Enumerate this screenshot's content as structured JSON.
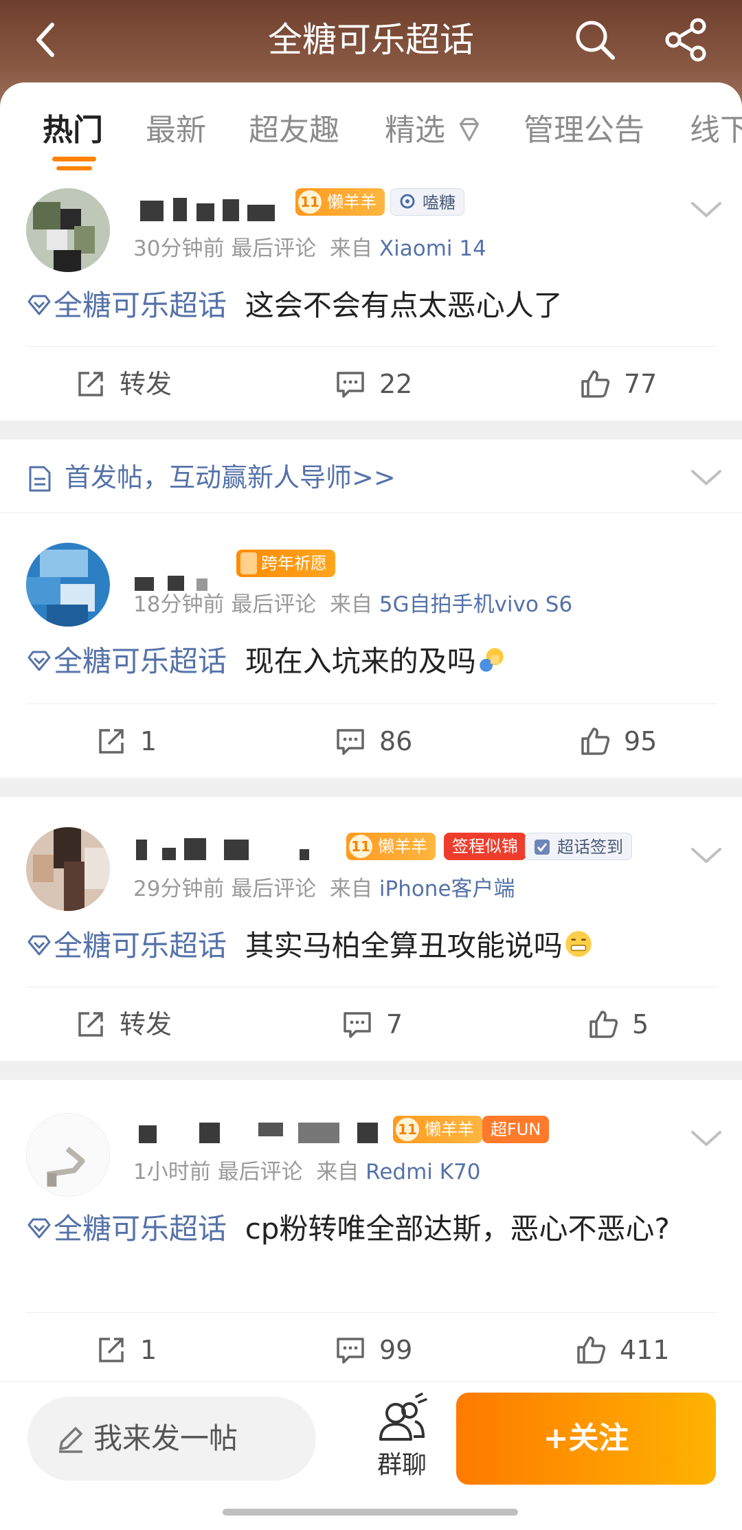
{
  "header": {
    "title": "全糖可乐超话"
  },
  "tabs": [
    "热门",
    "最新",
    "超友趣",
    "精选",
    "管理公告",
    "线下"
  ],
  "colors": {
    "accent": "#ff8200",
    "link": "#5572a8",
    "header_bg": "#6e3f2c"
  },
  "posts": [
    {
      "badges": [
        "懒羊羊",
        "嗑糖"
      ],
      "badge_level": "11",
      "meta": {
        "time": "30分钟前",
        "sort": "最后评论",
        "from_prefix": "来自",
        "source": "Xiaomi 14"
      },
      "topic": "全糖可乐超话",
      "text": "这会不会有点太恶心人了",
      "actions": {
        "repost": "转发",
        "comments": "22",
        "likes": "77"
      }
    },
    {
      "badges": [
        "跨年祈愿"
      ],
      "meta": {
        "time": "18分钟前",
        "sort": "最后评论",
        "from_prefix": "来自",
        "source": "5G自拍手机vivo S6"
      },
      "topic": "全糖可乐超话",
      "text": "现在入坑来的及吗",
      "actions": {
        "repost": "1",
        "comments": "86",
        "likes": "95"
      }
    },
    {
      "badges": [
        "懒羊羊",
        "签程似锦",
        "超话签到"
      ],
      "badge_level": "11",
      "meta": {
        "time": "29分钟前",
        "sort": "最后评论",
        "from_prefix": "来自",
        "source": "iPhone客户端"
      },
      "topic": "全糖可乐超话",
      "text": "其实马柏全算丑攻能说吗",
      "actions": {
        "repost": "转发",
        "comments": "7",
        "likes": "5"
      }
    },
    {
      "badges": [
        "懒羊羊",
        "超FUN"
      ],
      "badge_level": "11",
      "meta": {
        "time": "1小时前",
        "sort": "最后评论",
        "from_prefix": "来自",
        "source": "Redmi K70"
      },
      "topic": "全糖可乐超话",
      "text": "cp粉转唯全部达斯，恶心不恶心?",
      "actions": {
        "repost": "1",
        "comments": "99",
        "likes": "411"
      }
    }
  ],
  "notice": {
    "text": "首发帖，互动赢新人导师>>"
  },
  "bottom": {
    "compose": "我来发一帖",
    "group_chat": "群聊",
    "follow": "+关注"
  }
}
